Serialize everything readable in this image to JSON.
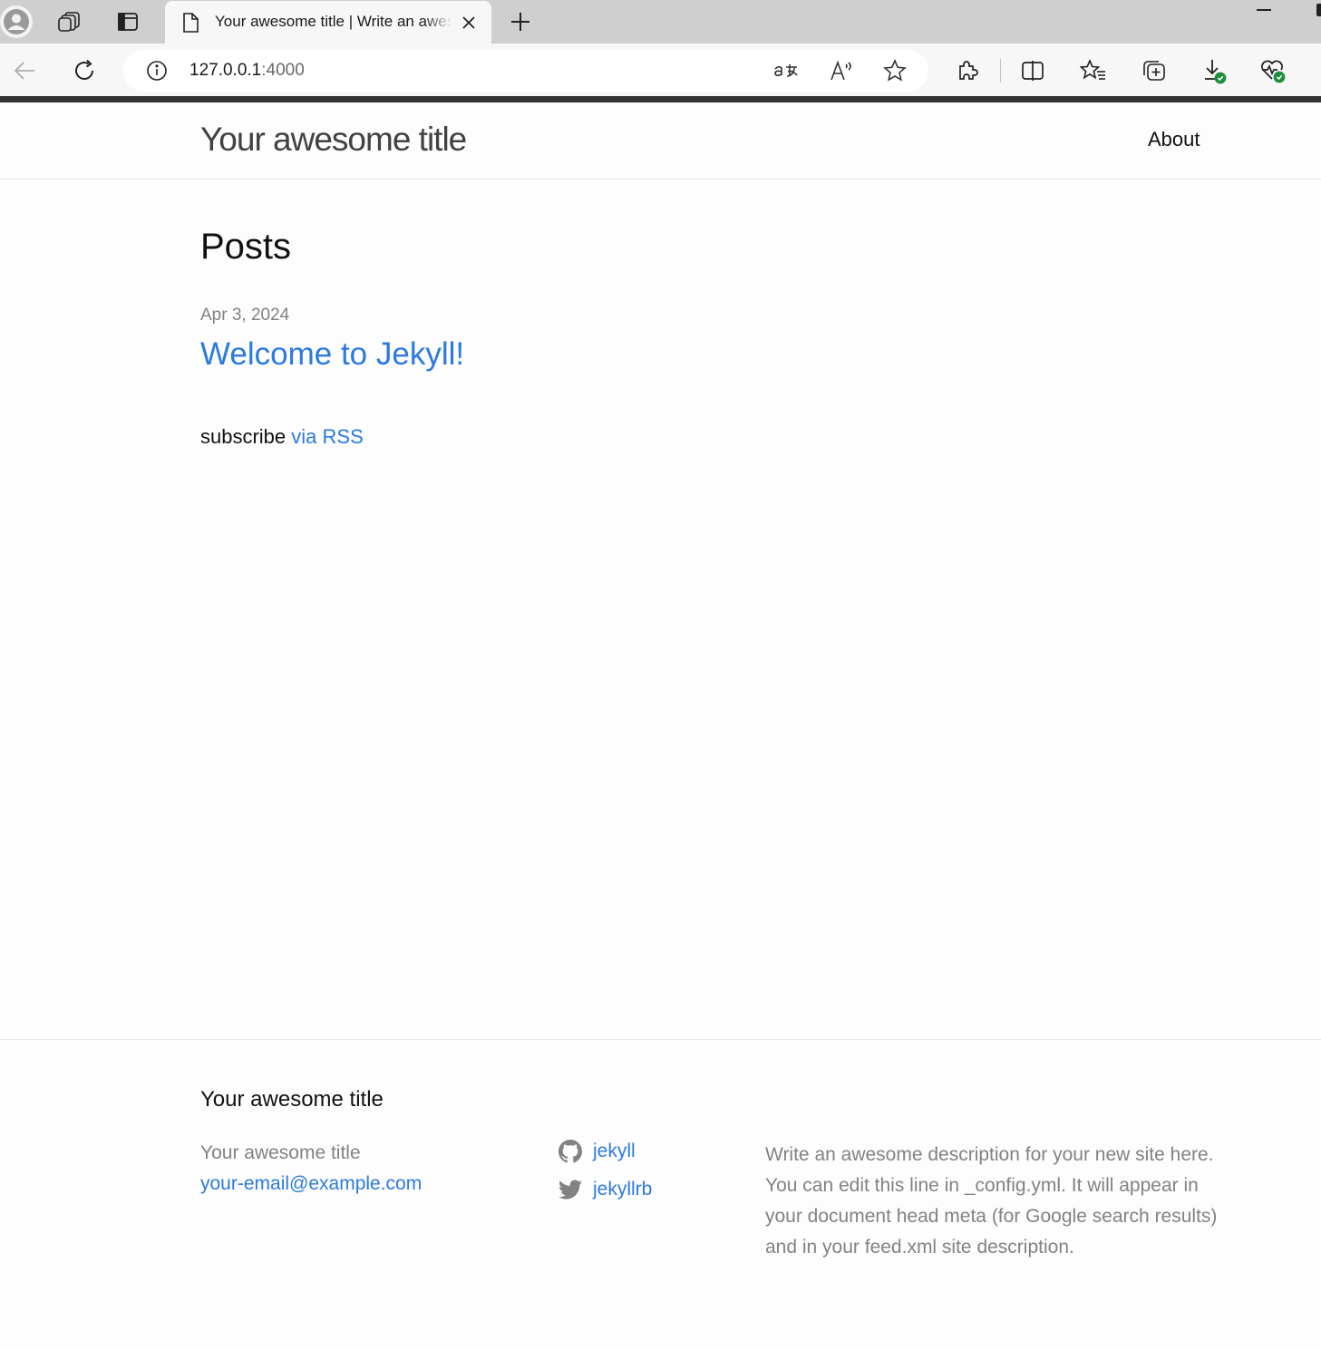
{
  "browser": {
    "tab_title": "Your awesome title | Write an awesome description for your new site here.",
    "url_host": "127.0.0.1",
    "url_port": ":4000",
    "icons": [
      "profile-icon",
      "workspaces-icon",
      "vertical-tabs-icon",
      "page-icon",
      "close-icon",
      "new-tab-icon",
      "back-icon",
      "reload-icon",
      "info-icon",
      "translate-icon",
      "read-aloud-icon",
      "favorite-star-icon",
      "extensions-icon",
      "split-screen-icon",
      "favorites-icon",
      "collections-icon",
      "downloads-icon",
      "browser-essentials-icon"
    ]
  },
  "header": {
    "site_title": "Your awesome title",
    "nav": {
      "about": "About"
    }
  },
  "main": {
    "heading": "Posts",
    "posts": [
      {
        "date": "Apr 3, 2024",
        "title": "Welcome to Jekyll!"
      }
    ],
    "subscribe_text": "subscribe",
    "rss_link": "via RSS"
  },
  "footer": {
    "heading": "Your awesome title",
    "name": "Your awesome title",
    "email": "your-email@example.com",
    "github": "jekyll",
    "twitter": "jekyllrb",
    "description": "Write an awesome description for your new site here. You can edit this line in _config.yml. It will appear in your document head meta (for Google search results) and in your feed.xml site description."
  },
  "colors": {
    "link": "#2a7ae2",
    "muted": "#828282",
    "text": "#111111",
    "download_badge": "#1e8e3e"
  }
}
